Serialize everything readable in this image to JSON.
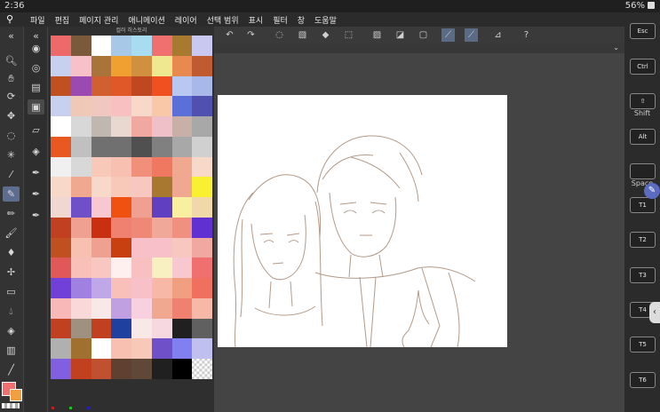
{
  "status_bar": {
    "time": "2:36",
    "battery": "56%"
  },
  "menu": {
    "items": [
      "파일",
      "편집",
      "페이지 관리",
      "애니메이션",
      "레이어",
      "선택 범위",
      "표시",
      "필터",
      "창",
      "도움말"
    ]
  },
  "panel": {
    "title": "컬러 히스토리"
  },
  "palette": [
    [
      "#ee6a6a",
      "#7a5a3a",
      "#ffffff",
      "#a8c8e8",
      "#a8dcf0",
      "#f07070",
      "#a87a30",
      "#c8c8f0"
    ],
    [
      "#c8d0f0",
      "#f8c0c8",
      "#a8743a",
      "#f0a030",
      "#d09040",
      "#f0e890",
      "#e88a50",
      "#c05a30"
    ],
    [
      "#c05020",
      "#9a4ab0",
      "#d06030",
      "#e05828",
      "#c04820",
      "#f05020",
      "#b8c8f0",
      "#a8b8e8"
    ],
    [
      "#c8d0f0",
      "#f0c8b8",
      "#f0c8c0",
      "#f8c0c0",
      "#f8d8c8",
      "#f8c8a8",
      "#5a70d8",
      "#5050b0"
    ],
    [
      "#ffffff",
      "#d8d8d8",
      "#c0b8b0",
      "#e8d8d0",
      "#f0a8a0",
      "#f0c0c8",
      "#c8b0a8",
      "#a8a8a8"
    ],
    [
      "#e85820",
      "#c0c0c0",
      "#707070",
      "#707070",
      "#505050",
      "#808080",
      "#a8a8a8",
      "#d0d0d0"
    ],
    [
      "#f0f0f0",
      "#d8d8d8",
      "#f8c8b8",
      "#f8c0b0",
      "#f0907a",
      "#f07860",
      "#f0a890",
      "#f8d8c8"
    ],
    [
      "#f8d8c8",
      "#f0a890",
      "#f8d8c8",
      "#f8c8b8",
      "#f8c8c0",
      "#a87830",
      "#f0a890",
      "#f8f030"
    ],
    [
      "#f0d8d0",
      "#7050c8",
      "#f8c8d0",
      "#f05010",
      "#f0a090",
      "#6040c0",
      "#f8f0a0",
      "#f0d8a8"
    ],
    [
      "#c04020",
      "#f0a090",
      "#c83010",
      "#f08070",
      "#f08878",
      "#f0a898",
      "#f09080",
      "#6030d0"
    ],
    [
      "#c05020",
      "#f8c0b0",
      "#f0a090",
      "#c84010",
      "#f8c0c8",
      "#f8c0c8",
      "#f8c8c0",
      "#f0a8a0"
    ],
    [
      "#e05858",
      "#f8c0b8",
      "#f8c8c0",
      "#fff0f0",
      "#f8c0c0",
      "#f8f0c0",
      "#f8c8d0",
      "#f07070"
    ],
    [
      "#7040d8",
      "#a080e0",
      "#c0a8e8",
      "#f8c0b8",
      "#f8c0c8",
      "#f8b8a8",
      "#f0a080",
      "#f07060"
    ],
    [
      "#f8b8b8",
      "#f8d8d8",
      "#f8e8e8",
      "#c0a0e0",
      "#f8d0e0",
      "#f0a890",
      "#f08070",
      "#f8b8a8"
    ],
    [
      "#c04020",
      "#a09080",
      "#c04020",
      "#2040a0",
      "#f8e8e8",
      "#f8d8e0",
      "#202020",
      "#606060"
    ],
    [
      "#b0b0b0",
      "#a07030",
      "#ffffff",
      "#f8c0b0",
      "#f8c8b8",
      "#7050c8",
      "#8080f0",
      "#c0c0f0"
    ],
    [
      "#8060e0",
      "#c04020",
      "#c05030",
      "#604030",
      "#604838",
      "#202020",
      "#000000",
      "#e0e0e0"
    ]
  ],
  "keys": [
    "Esc",
    "Ctrl",
    "Shift",
    "Alt",
    "Space",
    "T1",
    "T2",
    "T3",
    "T4",
    "T5",
    "T6"
  ],
  "key_labels": {
    "shift": "Shift",
    "space": "Space"
  }
}
